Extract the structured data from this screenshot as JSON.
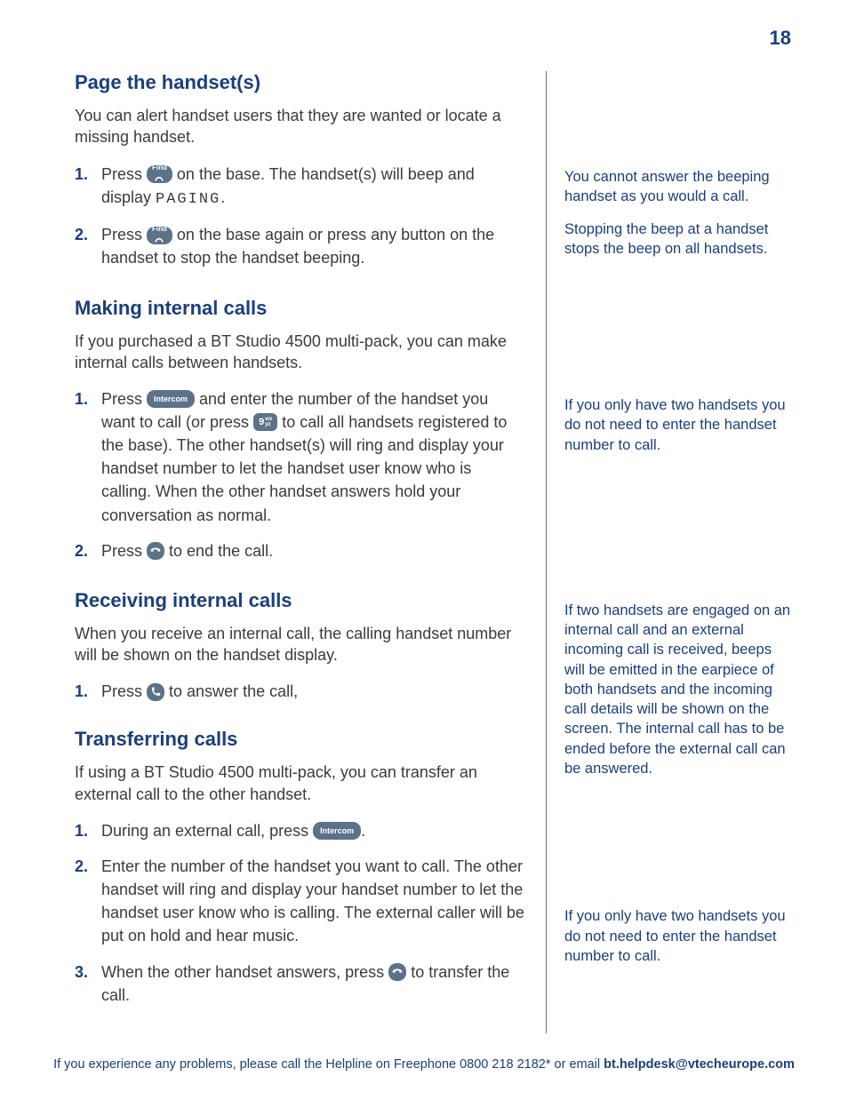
{
  "page_number": "18",
  "sections": {
    "page_handsets": {
      "title": "Page the handset(s)",
      "intro": "You can alert handset users that they are wanted or locate a missing handset.",
      "steps": {
        "s1_a": "Press ",
        "s1_b": " on the base. The handset(s) will beep and display ",
        "s1_paging": "PAGING",
        "s1_c": ".",
        "s2_a": "Press ",
        "s2_b": " on the base again or press any button on the handset to stop the handset beeping."
      }
    },
    "making": {
      "title": "Making internal calls",
      "intro": "If you purchased a BT Studio 4500 multi-pack, you can make internal calls between handsets.",
      "steps": {
        "s1_a": "Press ",
        "s1_b": " and enter the number of the handset you want to call (or press ",
        "s1_c": " to call all handsets registered to the base). The other handset(s) will ring and display your handset number to let the handset user know who is calling. When the other handset answers hold your conversation as normal.",
        "s2_a": "Press ",
        "s2_b": " to end the call."
      }
    },
    "receiving": {
      "title": "Receiving internal calls",
      "intro": "When you receive an internal call, the calling handset number will be shown on the handset display.",
      "steps": {
        "s1_a": "Press ",
        "s1_b": " to answer the call,"
      }
    },
    "transferring": {
      "title": "Transferring calls",
      "intro": "If using a BT Studio 4500 multi-pack, you can transfer an external call to the other handset.",
      "steps": {
        "s1_a": "During an external call, press ",
        "s1_b": ".",
        "s2": "Enter the number of the handset you want to call. The other handset will ring and display your handset number to let the handset user know who is calling. The external caller will be put on hold and hear music.",
        "s3_a": "When the other handset answers, press ",
        "s3_b": " to transfer the call."
      }
    }
  },
  "side": {
    "note1": "You cannot answer the beeping handset as you would a call.",
    "note2": "Stopping the beep at a handset stops the beep on all handsets.",
    "note3": "If you only have two handsets you do not need to enter the handset number to call.",
    "note4": "If two handsets are engaged on an internal call and an external incoming call is received, beeps will be emitted in the earpiece of both handsets and the incoming call details will be shown on the screen. The internal call has to be ended before the external call can be answered.",
    "note5": "If you only have two handsets you do not need to enter the handset number to call."
  },
  "keys": {
    "find": "Find",
    "intercom": "Intercom",
    "nine": "9"
  },
  "footer": {
    "a": "If you experience any problems, please call the Helpline on Freephone 0800 218 2182* or email ",
    "b": "bt.helpdesk@vtecheurope.com"
  }
}
